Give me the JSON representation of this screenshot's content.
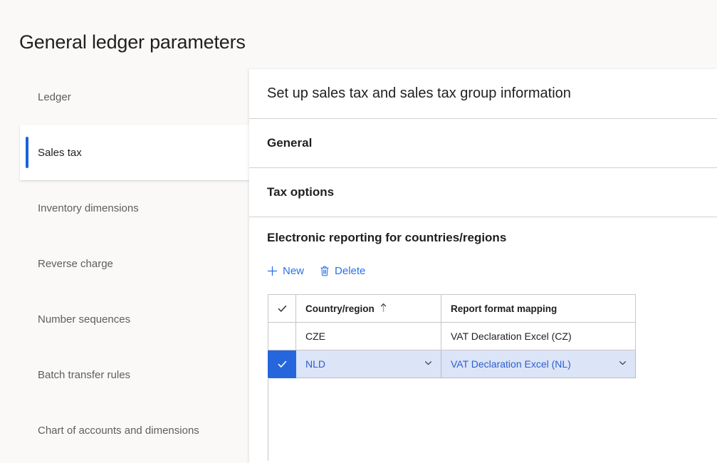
{
  "page": {
    "title": "General ledger parameters"
  },
  "sidebar": {
    "items": [
      {
        "label": "Ledger",
        "selected": false
      },
      {
        "label": "Sales tax",
        "selected": true
      },
      {
        "label": "Inventory dimensions",
        "selected": false
      },
      {
        "label": "Reverse charge",
        "selected": false
      },
      {
        "label": "Number sequences",
        "selected": false
      },
      {
        "label": "Batch transfer rules",
        "selected": false
      },
      {
        "label": "Chart of accounts and dimensions",
        "selected": false
      }
    ]
  },
  "content": {
    "header": "Set up sales tax and sales tax group information",
    "sections": [
      {
        "title": "General"
      },
      {
        "title": "Tax options"
      },
      {
        "title": "Electronic reporting for countries/regions"
      }
    ],
    "toolbar": {
      "new_label": "New",
      "new_icon": "plus-icon",
      "delete_label": "Delete",
      "delete_icon": "trash-icon"
    },
    "grid": {
      "columns": [
        {
          "key": "check",
          "label": "",
          "icon": "checkmark-icon"
        },
        {
          "key": "country",
          "label": "Country/region",
          "sort": "ascending",
          "sort_icon": "sort-ascending-icon"
        },
        {
          "key": "mapping",
          "label": "Report format mapping"
        }
      ],
      "rows": [
        {
          "selected": false,
          "country": "CZE",
          "mapping": "VAT Declaration Excel (CZ)"
        },
        {
          "selected": true,
          "country": "NLD",
          "mapping": "VAT Declaration Excel (NL)",
          "country_dropdown_icon": "chevron-down-icon",
          "mapping_dropdown_icon": "chevron-down-icon",
          "row_check_icon": "checkmark-icon"
        }
      ]
    }
  },
  "colors": {
    "accent_blue": "#1b62de",
    "link_blue": "#2b70e8",
    "selected_row_bg": "#dce4f7",
    "selected_check_bg": "#2566dd",
    "page_bg": "#faf9f8",
    "panel_bg": "#ffffff",
    "divider": "#d2d0ce",
    "grid_border": "#c8c6c4"
  }
}
